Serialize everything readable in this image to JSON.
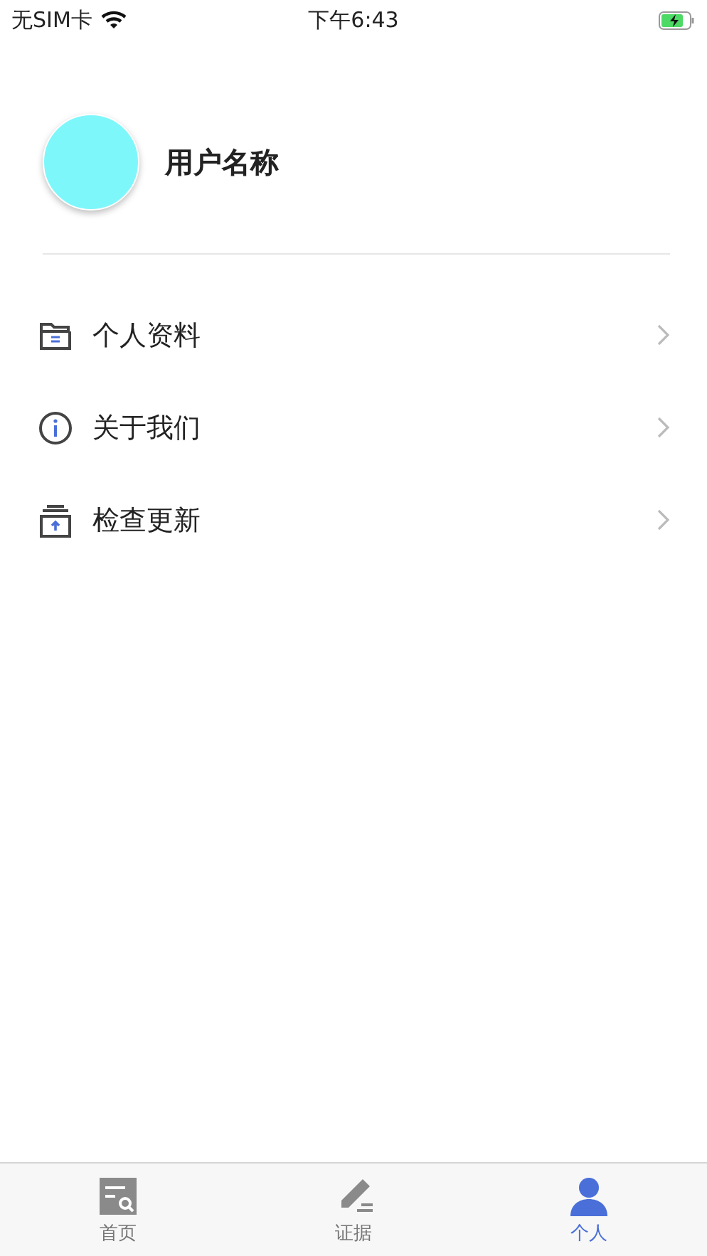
{
  "status_bar": {
    "carrier": "无SIM卡",
    "time": "下午6:43"
  },
  "profile": {
    "name": "用户名称"
  },
  "menu": [
    {
      "kind": "folder",
      "label": "个人资料"
    },
    {
      "kind": "info",
      "label": "关于我们"
    },
    {
      "kind": "upload",
      "label": "检查更新"
    }
  ],
  "tab_bar": [
    {
      "kind": "home",
      "label": "首页",
      "selected": false
    },
    {
      "kind": "evidence",
      "label": "证据",
      "selected": false
    },
    {
      "kind": "person",
      "label": "个人",
      "selected": true
    }
  ]
}
